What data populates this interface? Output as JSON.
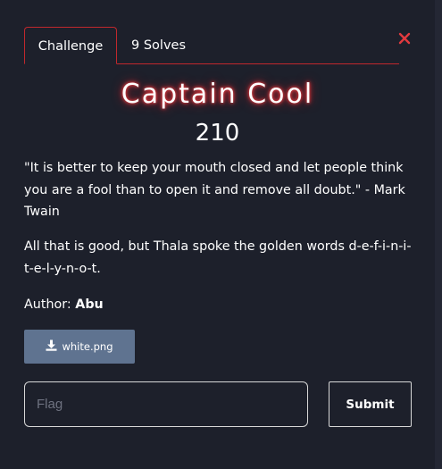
{
  "tabs": {
    "challenge": "Challenge",
    "solves": "9 Solves"
  },
  "challenge": {
    "name": "Captain Cool",
    "points": "210",
    "description_1": "\"It is better to keep your mouth closed and let people think you are a fool than to open it and remove all doubt.\" - Mark Twain",
    "description_2": "All that is good, but Thala spoke the golden words d-e-f-i-n-i-t-e-l-y-n-o-t.",
    "author_label": "Author:",
    "author_name": "Abu"
  },
  "file": {
    "name": "white.png",
    "icon": "download-icon"
  },
  "form": {
    "flag_placeholder": "Flag",
    "flag_value": "",
    "submit_label": "Submit"
  },
  "colors": {
    "background": "#1d202b",
    "accent_red": "#c0282d",
    "file_button": "#5f7390"
  },
  "icons": {
    "close": "close-icon"
  }
}
